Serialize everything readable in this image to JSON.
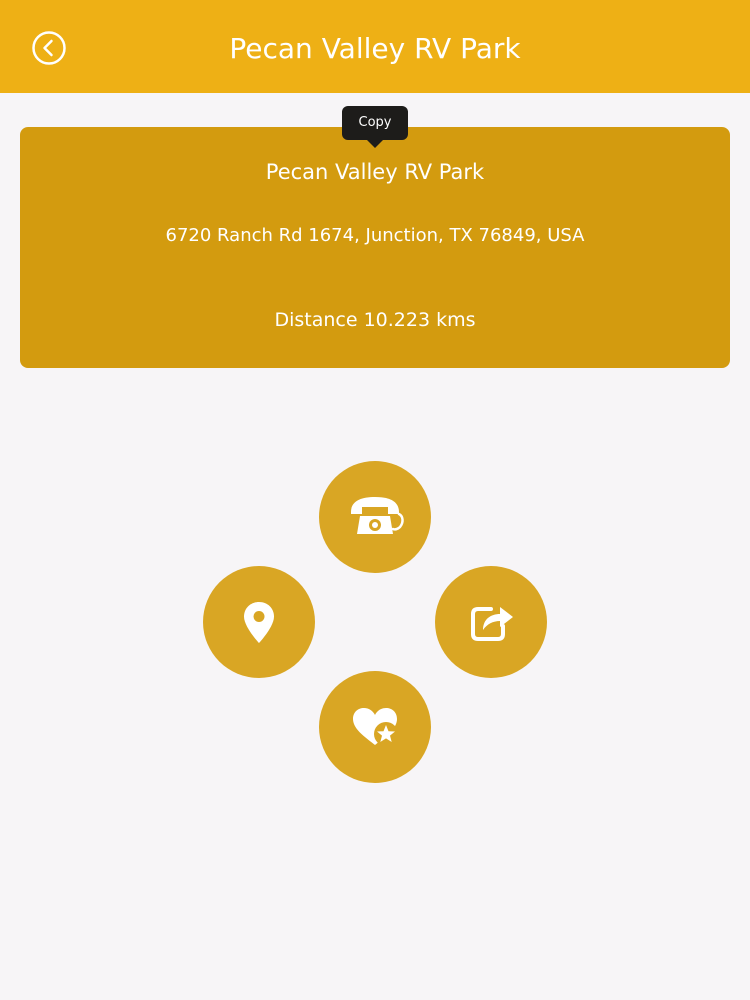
{
  "header": {
    "title": "Pecan Valley RV Park",
    "back_icon": "chevron-left-circle-icon",
    "background_color": "#eeb015"
  },
  "tooltip": {
    "label": "Copy"
  },
  "place": {
    "name": "Pecan Valley RV Park",
    "address": "6720 Ranch Rd 1674, Junction, TX 76849, USA",
    "distance": "Distance 10.223 kms",
    "card_color": "#d39b0f"
  },
  "actions": [
    {
      "name": "call",
      "icon": "telephone-icon"
    },
    {
      "name": "map",
      "icon": "map-pin-icon"
    },
    {
      "name": "share",
      "icon": "share-icon"
    },
    {
      "name": "favorite",
      "icon": "heart-star-icon"
    }
  ],
  "colors": {
    "accent": "#eeb015",
    "button": "#d9a624",
    "background": "#f7f5f7",
    "text_on_accent": "#ffffff"
  }
}
